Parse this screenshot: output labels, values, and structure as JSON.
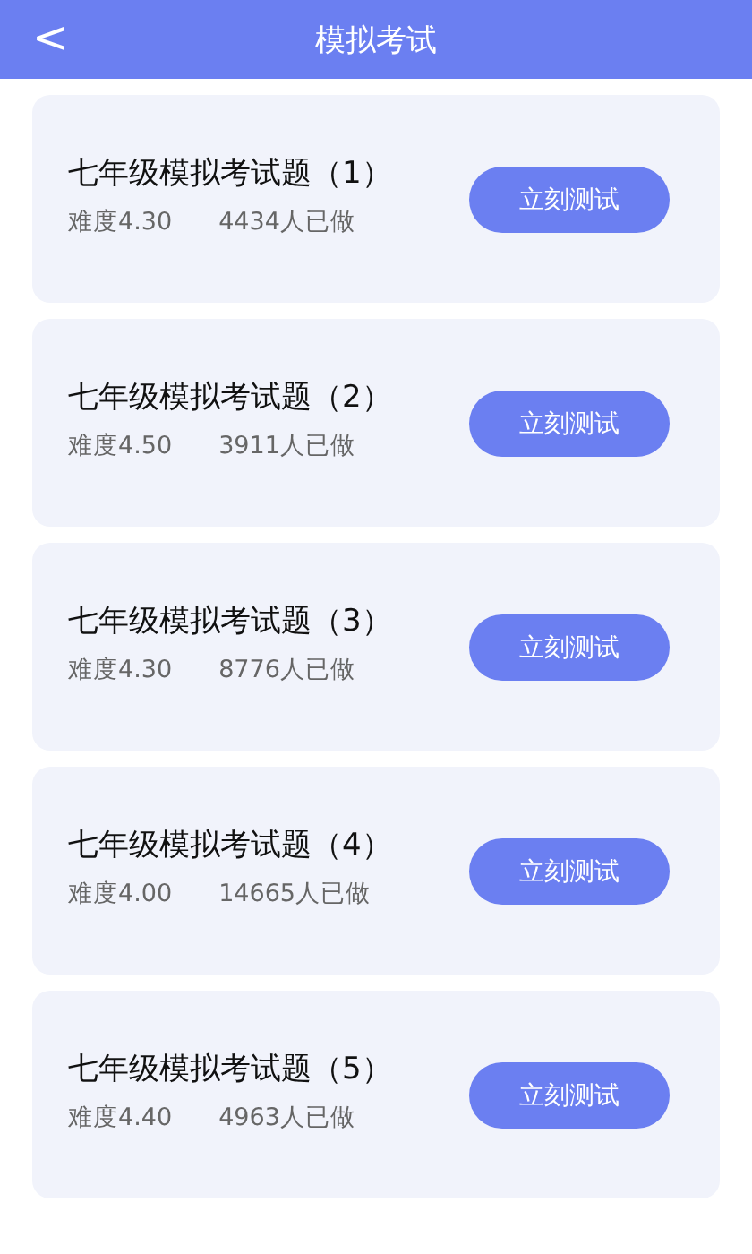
{
  "header": {
    "back_icon": "<",
    "title": "模拟考试"
  },
  "exams": [
    {
      "title": "七年级模拟考试题（1）",
      "difficulty": "难度4.30",
      "count": "4434人已做",
      "button": "立刻测试"
    },
    {
      "title": "七年级模拟考试题（2）",
      "difficulty": "难度4.50",
      "count": "3911人已做",
      "button": "立刻测试"
    },
    {
      "title": "七年级模拟考试题（3）",
      "difficulty": "难度4.30",
      "count": "8776人已做",
      "button": "立刻测试"
    },
    {
      "title": "七年级模拟考试题（4）",
      "difficulty": "难度4.00",
      "count": "14665人已做",
      "button": "立刻测试"
    },
    {
      "title": "七年级模拟考试题（5）",
      "difficulty": "难度4.40",
      "count": "4963人已做",
      "button": "立刻测试"
    }
  ]
}
